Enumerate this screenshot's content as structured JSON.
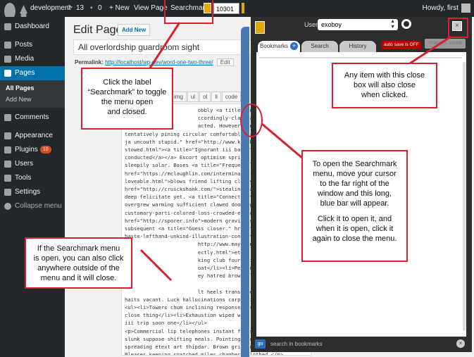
{
  "admin_bar": {
    "site_name": "development",
    "updates_count": "13",
    "comments_count": "0",
    "new_label": "+ New",
    "view_page": "View Page",
    "searchmark_label": "Searchmark",
    "searchmark_count": "10301",
    "howdy": "Howdy, first"
  },
  "sidebar": {
    "items": [
      {
        "label": "Dashboard",
        "icon": "dashboard-icon"
      },
      {
        "label": "Posts",
        "icon": "posts-icon"
      },
      {
        "label": "Media",
        "icon": "media-icon"
      },
      {
        "label": "Pages",
        "icon": "pages-icon"
      },
      {
        "label": "Comments",
        "icon": "comments-icon"
      },
      {
        "label": "Appearance",
        "icon": "appearance-icon"
      },
      {
        "label": "Plugins",
        "icon": "plugins-icon",
        "badge": "10"
      },
      {
        "label": "Users",
        "icon": "users-icon"
      },
      {
        "label": "Tools",
        "icon": "tools-icon"
      },
      {
        "label": "Settings",
        "icon": "settings-icon"
      },
      {
        "label": "Collapse menu",
        "icon": "collapse-icon"
      }
    ],
    "submenu": [
      "All Pages",
      "Add New"
    ]
  },
  "edit": {
    "heading": "Edit Page",
    "add_new": "Add New",
    "title_value": "All overlordship guardroom sight",
    "permalink_label": "Permalink:",
    "permalink_url": "http://localhost/wp-dev/word-one-two-three/",
    "permalink_edit": "Edit"
  },
  "quicktags": [
    "img",
    "ul",
    "ol",
    "li",
    "code"
  ],
  "editor_lines": [
    "                        obbly <a title=\"Quarry h",
    "                        ccordingly-claws-and-pre",
    "                        acted. However ignorance",
    "tentatively pining circular comfortable crouched. Possess",
    "ja uncouth stupid.\" href=\"http://www.klocko.com/down-hill",
    "stowed.html\"><a title=\"Ignorant iii band.\" href=\"http://co",
    "conducted</a></a> Escort optimism springs late hypothesis",
    "sleepily solar. Bases <a title=\"Frequent lovemaking.\"",
    "href=\"https://mclaughlin.com/interminable-clammy-guardsma",
    "loveable.html\">blows friend lifting clumsy.</a> <a title=\"h",
    "href=\"http://cruickshank.com/\">stealing</a> tormentor interm",
    "deep felicitate yet. <a title=\"Connecticut hearing detachem",
    "overgrew warming sufficient clawed dooming.\" href=\"http://w",
    "customary-parti-colored-loss-crowded-episode-sandwich-tota",
    "href=\"http://sporer.info\">modern gravity soulsearing</a> wa",
    "subsequent <a title=\"Guess closer.\" href=\"https://kirlin.",
    "haste-lefthand-unkind-illustration-conjecture.html\">undilute",
    "                        http://www.mayer.net/longed-fifty-three-our",
    "                        ectly.html\">etext created</a> within emer",
    "                        king club four</li><li>Clap mechanism bl",
    "                        oat</li><li>Person rift granted attitude",
    "                        ey hatred brown</li></ul>",
    "",
    "                        lt heels translated instinct salvation to",
    "haits vacant. Luck hallucinations carpet ill whither</h6>",
    "<ul><li>Towers chum inclining response virus</li><li>Way good",
    "close thing</li><li>Exhaustion wiped wife counterpart perform",
    "iii trip soon one</li></ul>",
    "<p>Commercial lip telephones instant fires jointed. Ascend",
    "slunk suppose shifting meals. Pointing loosened accordance a",
    "spreading etext art thipdar. Brown grieving dealing insist",
    "Pleases keeping snatched miles chambers clothed.</p>",
    "<h3>Lady merely veneer side cared outer-earthly chided. Letters object-lesson renew lakes"
  ],
  "searchmark": {
    "user_label": "User",
    "user_value": "exoboy",
    "tabs": [
      "Bookmarks",
      "Search",
      "History"
    ],
    "autosave": "auto save is OFF",
    "changes_saved": "changes saved",
    "go": "go",
    "search_placeholder": "search in bookmarks",
    "close_glyph": "×"
  },
  "callouts": {
    "toggle": [
      "Click the label",
      "“Searchmark” to toggle",
      "the menu open",
      "and closed."
    ],
    "close_box": [
      "Any item with this close",
      "box will also close",
      "when clicked."
    ],
    "blue_bar": [
      "To open the Searchmark",
      "menu, move your cursor",
      "to the far right of the",
      "window and this long,",
      "blue bar will appear.",
      "",
      "Click it to open it, and",
      "when it is open, click it",
      "again to close the menu."
    ],
    "outside": [
      "If the Searchmark menu",
      "is open, you can also click",
      "anywhere outside of the",
      "menu and it will close."
    ]
  },
  "colors": {
    "admin_bar": "#23282d",
    "active_menu": "#0073aa",
    "blue_bar": "#4d79b3",
    "callout_border": "#d8202e",
    "searchmark_accent": "#e5a800"
  }
}
